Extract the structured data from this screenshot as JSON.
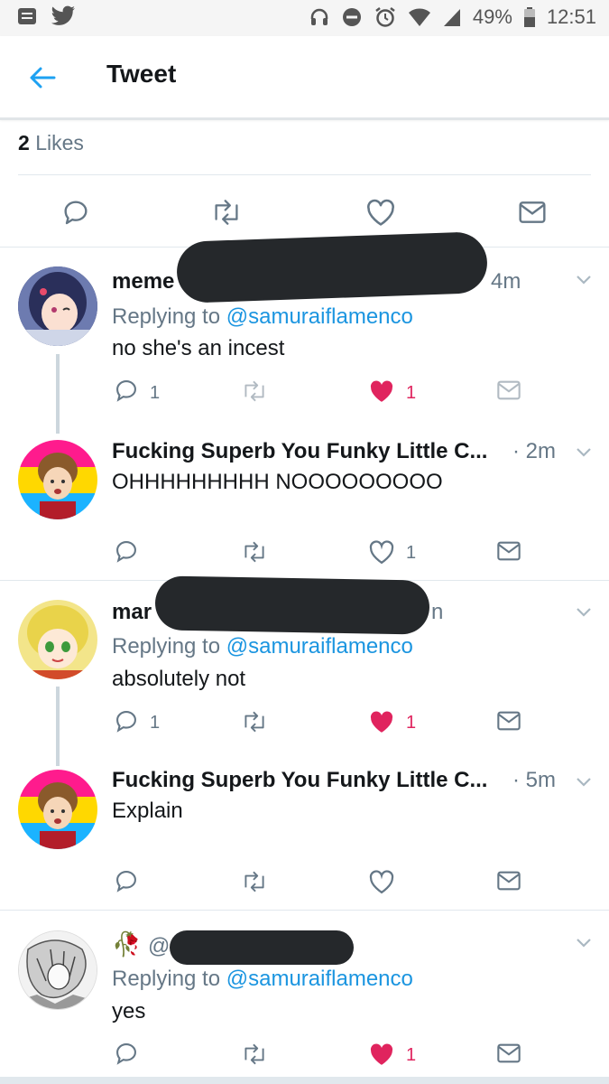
{
  "status_bar": {
    "battery": "49%",
    "time": "12:51"
  },
  "header": {
    "title": "Tweet"
  },
  "likes": {
    "count": "2",
    "label": "Likes"
  },
  "colors": {
    "accent": "#1da1f2",
    "like": "#e0245e",
    "muted": "#657786"
  },
  "replies": [
    {
      "name": "meme",
      "time": "4m",
      "replying_label": "Replying to",
      "handle": "@samuraiflamenco",
      "text": "no she's an incest",
      "reply_count": "1",
      "like_count": "1",
      "liked": true
    },
    {
      "name": "Fucking Superb You Funky Little C...",
      "time": "· 2m",
      "text": "OHHHHHHHHH NOOOOOOOOO",
      "like_count": "1",
      "liked": false
    },
    {
      "name": "mar",
      "time_fragment": "n",
      "replying_label": "Replying to",
      "handle": "@samuraiflamenco",
      "text": "absolutely not",
      "reply_count": "1",
      "like_count": "1",
      "liked": true
    },
    {
      "name": "Fucking Superb You Funky Little C...",
      "time": "· 5m",
      "text": "Explain"
    },
    {
      "emoji": "🥀",
      "at": "@",
      "replying_label": "Replying to",
      "handle": "@samuraiflamenco",
      "text": "yes",
      "like_count": "1",
      "liked": true
    }
  ]
}
